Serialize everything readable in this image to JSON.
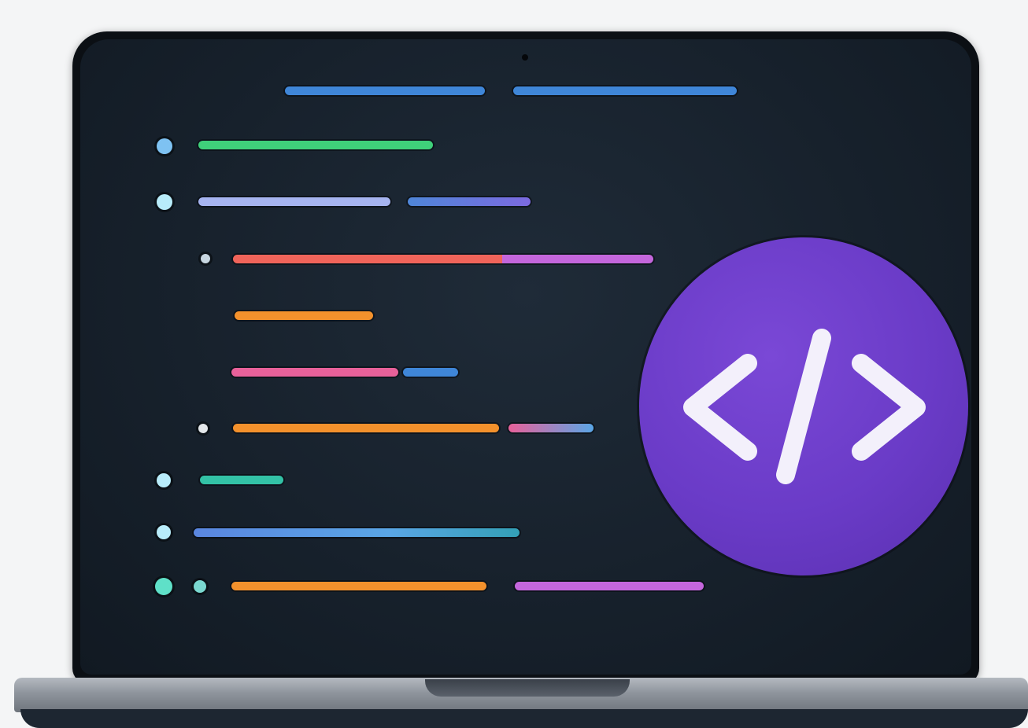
{
  "illustration": {
    "subject": "laptop",
    "badge_icon": "code-brackets-icon"
  },
  "palette": {
    "background": "#f4f5f6",
    "screen": "#17212c",
    "badge": "#6a3bc7",
    "green": "#3fd07a",
    "blue": "#3f86d8",
    "lavender": "#a6b4f0",
    "violet": "#7c6ae0",
    "coral": "#f0645a",
    "magenta": "#c466dc",
    "orange": "#f3912c",
    "pink": "#e8619a",
    "teal": "#33c2a6",
    "sky": "#5aa6e6"
  }
}
